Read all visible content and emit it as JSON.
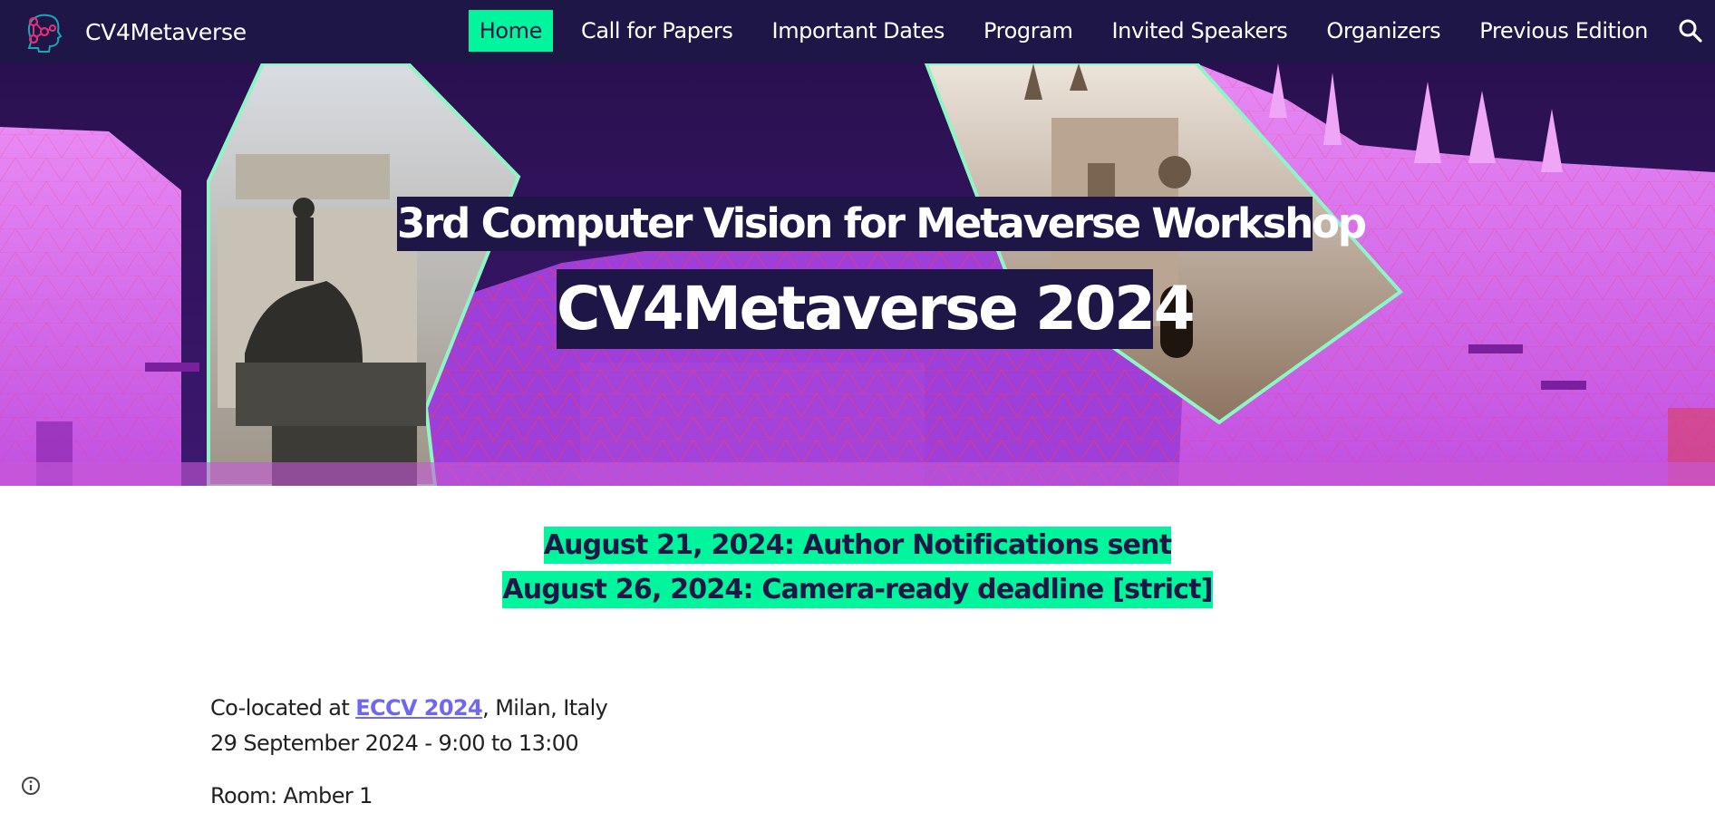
{
  "header": {
    "site_name": "CV4Metaverse",
    "logo_icon": "head-network-logo-icon",
    "nav": [
      {
        "label": "Home",
        "active": true
      },
      {
        "label": "Call for Papers",
        "active": false
      },
      {
        "label": "Important Dates",
        "active": false
      },
      {
        "label": "Program",
        "active": false
      },
      {
        "label": "Invited Speakers",
        "active": false
      },
      {
        "label": "Organizers",
        "active": false
      },
      {
        "label": "Previous Edition",
        "active": false
      }
    ],
    "search_icon": "search-icon"
  },
  "hero": {
    "subtitle": "3rd Computer Vision for Metaverse Workshop",
    "title": "CV4Metaverse 2024"
  },
  "announcements": [
    "August 21, 2024: Author Notifications sent",
    "August 26, 2024: Camera-ready deadline [strict]"
  ],
  "info": {
    "colocated_prefix": "Co-located at ",
    "colocated_link": "ECCV 2024",
    "colocated_suffix": ", Milan, Italy",
    "date_time": "29 September 2024 - 9:00 to 13:00",
    "room": "Room: Amber 1"
  },
  "footer": {
    "info_icon": "info-icon"
  },
  "colors": {
    "nav_bg": "#1e1646",
    "accent": "#00f59c",
    "link": "#7067f0",
    "hero_pink": "#e271f0",
    "hero_purple": "#2b1150"
  }
}
